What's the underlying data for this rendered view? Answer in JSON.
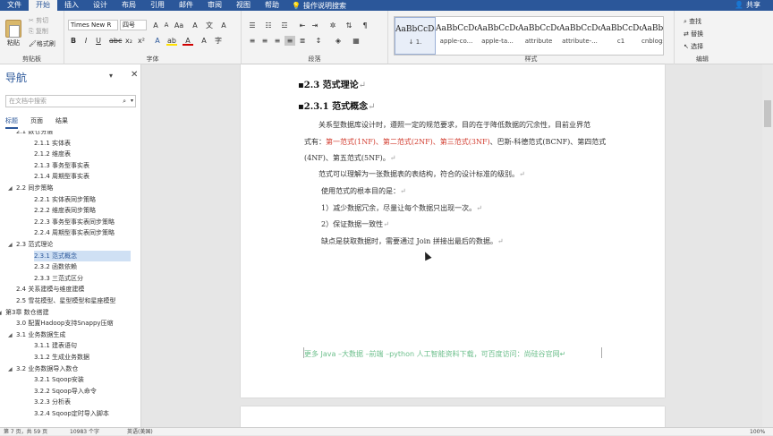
{
  "tabs": [
    "文件",
    "开始",
    "插入",
    "设计",
    "布局",
    "引用",
    "邮件",
    "审阅",
    "视图",
    "帮助"
  ],
  "tell_me": "操作说明搜索",
  "share": "共享",
  "clipboard": {
    "paste": "粘贴",
    "cut": "剪切",
    "copy": "复制",
    "format_painter": "格式刷",
    "label": "剪贴板"
  },
  "font": {
    "name": "Times New R",
    "size": "四号",
    "label": "字体"
  },
  "paragraph": {
    "label": "段落"
  },
  "styles": {
    "label": "样式",
    "items": [
      {
        "preview": "AaBbCcDd",
        "name": "↓ 1."
      },
      {
        "preview": "AaBbCcDc",
        "name": "apple-co..."
      },
      {
        "preview": "AaBbCcDc",
        "name": "apple-ta..."
      },
      {
        "preview": "AaBbCcDc",
        "name": "attribute"
      },
      {
        "preview": "AaBbCcDc",
        "name": "attribute-..."
      },
      {
        "preview": "AaBbCcDc",
        "name": "c1"
      },
      {
        "preview": "AaBbCcDc",
        "name": "cnblogs_..."
      }
    ]
  },
  "editing": {
    "find": "查找",
    "replace": "替换",
    "select": "选择",
    "label": "编辑"
  },
  "nav": {
    "title": "导航",
    "search_placeholder": "在文档中搜索",
    "tabs": [
      "标题",
      "页面",
      "结果"
    ],
    "items": [
      {
        "label": "2.1 数仓分层",
        "level": 2,
        "arrow": ""
      },
      {
        "label": "2.1.1 实体表",
        "level": 3,
        "arrow": ""
      },
      {
        "label": "2.1.2 维度表",
        "level": 3,
        "arrow": ""
      },
      {
        "label": "2.1.3 事务型事实表",
        "level": 3,
        "arrow": ""
      },
      {
        "label": "2.1.4 周期型事实表",
        "level": 3,
        "arrow": ""
      },
      {
        "label": "2.2 同步策略",
        "level": 2,
        "arrow": "◢"
      },
      {
        "label": "2.2.1 实体表同步策略",
        "level": 3,
        "arrow": ""
      },
      {
        "label": "2.2.2 维度表同步策略",
        "level": 3,
        "arrow": ""
      },
      {
        "label": "2.2.3 事务型事实表同步策略",
        "level": 3,
        "arrow": ""
      },
      {
        "label": "2.2.4 周期型事实表同步策略",
        "level": 3,
        "arrow": ""
      },
      {
        "label": "2.3 范式理论",
        "level": 2,
        "arrow": "◢"
      },
      {
        "label": "2.3.1 范式概念",
        "level": 3,
        "arrow": "",
        "selected": true
      },
      {
        "label": "2.3.2 函数依赖",
        "level": 3,
        "arrow": ""
      },
      {
        "label": "2.3.3 三范式区分",
        "level": 3,
        "arrow": ""
      },
      {
        "label": "2.4 关系建模与维度建模",
        "level": 2,
        "arrow": ""
      },
      {
        "label": "2.5 雪花模型、星型模型和星座模型",
        "level": 2,
        "arrow": ""
      },
      {
        "label": "第3章 数仓搭建",
        "level": 1,
        "arrow": "◢"
      },
      {
        "label": "3.0 配置Hadoop支持Snappy压缩",
        "level": 2,
        "arrow": ""
      },
      {
        "label": "3.1 业务数据生成",
        "level": 2,
        "arrow": "◢"
      },
      {
        "label": "3.1.1 建表语句",
        "level": 3,
        "arrow": ""
      },
      {
        "label": "3.1.2 生成业务数据",
        "level": 3,
        "arrow": ""
      },
      {
        "label": "3.2 业务数据导入数仓",
        "level": 2,
        "arrow": "◢"
      },
      {
        "label": "3.2.1 Sqoop安装",
        "level": 3,
        "arrow": ""
      },
      {
        "label": "3.2.2 Sqoop导入命令",
        "level": 3,
        "arrow": ""
      },
      {
        "label": "3.2.3 分析表",
        "level": 3,
        "arrow": ""
      },
      {
        "label": "3.2.4 Sqoop定时导入脚本",
        "level": 3,
        "arrow": ""
      }
    ]
  },
  "doc": {
    "h2": "2.3  范式理论",
    "h3": "2.3.1  范式概念",
    "para1_line1": "关系型数据库设计时，遵照一定的规范要求，目的在于降低数据的冗余性，目前业界范",
    "para1_line2_prefix": "式有：",
    "para1_line2_red": "第一范式(1NF)、第二范式(2NF)、第三范式(3NF)",
    "para1_line2_suffix": "、巴斯-科德范式(BCNF)、第四范式",
    "para1_line3": "(4NF)、第五范式(5NF)。",
    "para2": "范式可以理解为一张数据表的表结构，符合的设计标准的级别。",
    "para3": "使用范式的根本目的是：",
    "list1": "1）减少数据冗余，尽量让每个数据只出现一次。",
    "list2": "2）保证数据一致性",
    "para4": "缺点是获取数据时，需要通过 Join 拼接出最后的数据。",
    "para_mark": "↵",
    "footer_note": "更多 Java –大数据 –前端 –python 人工智能资料下载，可百度访问：尚硅谷官网"
  },
  "status": {
    "page": "第 7 页，共 59 页",
    "words": "10983 个字",
    "lang": "英语(美国)",
    "zoom": "100%"
  }
}
